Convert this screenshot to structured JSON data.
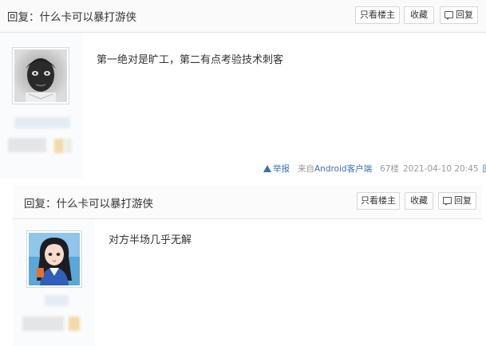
{
  "posts": [
    {
      "title": "回复：什么卡可以暴打游侠",
      "buttons": {
        "only_op": "只看楼主",
        "favorite": "收藏",
        "reply": "回复"
      },
      "content": "第一绝对是旷工，第二有点考验技术刺客",
      "meta": {
        "report": "举报",
        "source": "来自Android客户端",
        "floor": "67楼",
        "time": "2021-04-10 20:45",
        "reply": "回复"
      }
    },
    {
      "title": "回复：什么卡可以暴打游侠",
      "buttons": {
        "only_op": "只看楼主",
        "favorite": "收藏",
        "reply": "回复"
      },
      "content": "对方半场几乎无解"
    }
  ],
  "colors": {
    "link": "#3c6fb4",
    "border": "#e3e3e3",
    "badge": "#f3d9a8"
  }
}
